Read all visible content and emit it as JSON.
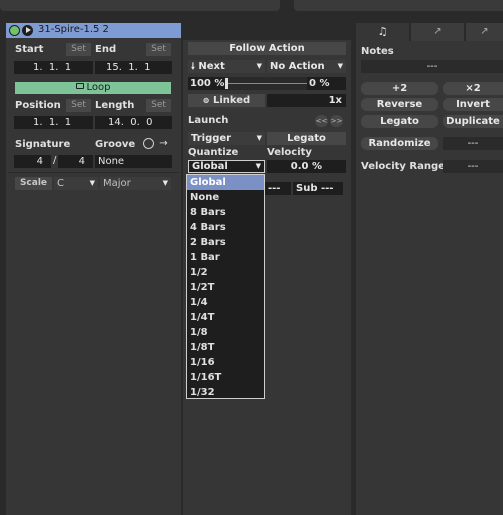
{
  "clip": {
    "title": "31-Spire-1.5 2"
  },
  "clip_box": {
    "start_label": "Start",
    "end_label": "End",
    "set_label": "Set",
    "start_value": "1.  1.  1",
    "end_value": "15.  1.  1",
    "loop_label": "Loop",
    "position_label": "Position",
    "length_label": "Length",
    "position_value": "1.  1.  1",
    "length_value": "14.  0.  0",
    "signature_label": "Signature",
    "groove_label": "Groove",
    "sig_numerator": "4",
    "sig_sep": "/",
    "sig_denominator": "4",
    "groove_value": "None",
    "scale_label": "Scale",
    "scale_root": "C",
    "scale_mode": "Major"
  },
  "follow_action": {
    "header": "Follow Action",
    "action_a": "Next",
    "action_a_icon": "arrow-down-icon",
    "action_b": "No Action",
    "chance_a": "100 %",
    "chance_b": "0 %",
    "linked_label": "Linked",
    "multiplier": "1x"
  },
  "launch": {
    "header": "Launch",
    "mode": "Trigger",
    "legato_label": "Legato",
    "quantize_label": "Quantize",
    "velocity_label": "Velocity",
    "quantize_value": "Global",
    "velocity_value": "0.0 %",
    "sub_label": "Sub ---",
    "partial_label": "---"
  },
  "quantize_menu": {
    "options": [
      "Global",
      "None",
      "8 Bars",
      "4 Bars",
      "2 Bars",
      "1 Bar",
      "1/2",
      "1/2T",
      "1/4",
      "1/4T",
      "1/8",
      "1/8T",
      "1/16",
      "1/16T",
      "1/32"
    ],
    "selected": "Global"
  },
  "notes": {
    "header": "Notes",
    "range_value": "---",
    "btn_plus2": "+2",
    "btn_x2": "×2",
    "btn_reverse": "Reverse",
    "btn_invert": "Invert",
    "btn_legato": "Legato",
    "btn_duplicate": "Duplicate",
    "btn_randomize": "Randomize",
    "randomize_value": "---",
    "velocity_range_label": "Velocity Range",
    "velocity_range_value": "---"
  },
  "colors": {
    "title_bar": "#7e9bd4",
    "loop_active": "#7fc499",
    "menu_selected": "#7b91c6",
    "clip_active_dot": "#72c26a"
  }
}
